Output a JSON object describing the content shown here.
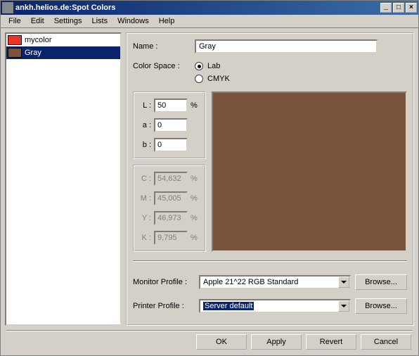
{
  "window": {
    "title": "ankh.helios.de:Spot Colors"
  },
  "menus": [
    "File",
    "Edit",
    "Settings",
    "Lists",
    "Windows",
    "Help"
  ],
  "sidebar": {
    "items": [
      {
        "name": "mycolor",
        "swatch": "#ed3324",
        "selected": false
      },
      {
        "name": "Gray",
        "swatch": "#7a533b",
        "selected": true
      }
    ]
  },
  "form": {
    "name_label": "Name :",
    "name_value": "Gray",
    "colorspace_label": "Color Space :",
    "colorspace_options": [
      "Lab",
      "CMYK"
    ],
    "colorspace_selected": "Lab",
    "lab": {
      "L_label": "L :",
      "L_value": "50",
      "L_pct": "%",
      "a_label": "a :",
      "a_value": "0",
      "b_label": "b :",
      "b_value": "0"
    },
    "cmyk": {
      "C_label": "C :",
      "C_value": "54,632",
      "C_pct": "%",
      "M_label": "M :",
      "M_value": "45,005",
      "M_pct": "%",
      "Y_label": "Y :",
      "Y_value": "46,973",
      "Y_pct": "%",
      "K_label": "K :",
      "K_value": "9,795",
      "K_pct": "%"
    },
    "preview_color": "#7a533b",
    "monitor_profile_label": "Monitor Profile :",
    "monitor_profile_value": "Apple 21^22 RGB Standard",
    "printer_profile_label": "Printer Profile :",
    "printer_profile_value": "Server default",
    "browse_label": "Browse..."
  },
  "buttons": {
    "ok": "OK",
    "apply": "Apply",
    "revert": "Revert",
    "cancel": "Cancel"
  }
}
